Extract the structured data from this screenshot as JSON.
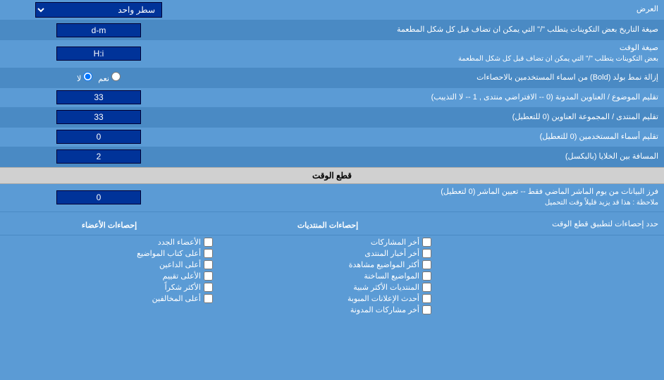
{
  "rows": [
    {
      "id": "row-single-line",
      "label": "",
      "input_type": "select",
      "input_value": "سطر واحد",
      "options": [
        "سطر واحد"
      ],
      "label_right": "العرض"
    },
    {
      "id": "row-date-format",
      "label": "صيغة التاريخ\nبعض التكوينات يتطلب \"/\" التي يمكن ان تضاف قبل كل شكل المطعمة",
      "input_type": "text",
      "input_value": "d-m",
      "label_right": ""
    },
    {
      "id": "row-time-format",
      "label": "صيغة الوقت\nبعض التكوينات يتطلب \"/\" التي يمكن ان تضاف قبل كل شكل المطعمة",
      "input_type": "text",
      "input_value": "H:i",
      "label_right": ""
    },
    {
      "id": "row-bold",
      "label": "إزالة نمط بولد (Bold) من اسماء المستخدمين بالاحصاءات",
      "input_type": "radio",
      "radio_options": [
        "نعم",
        "لا"
      ],
      "radio_selected": "لا",
      "label_right": ""
    },
    {
      "id": "row-sort-topics",
      "label": "تقليم الموضوع / العناوين المدونة (0 -- الافتراضي منتدى , 1 -- لا التذييب)",
      "input_type": "text",
      "input_value": "33",
      "label_right": ""
    },
    {
      "id": "row-sort-forum",
      "label": "تقليم المنتدى / المجموعة العناوين (0 للتعطيل)",
      "input_type": "text",
      "input_value": "33",
      "label_right": ""
    },
    {
      "id": "row-sort-usernames",
      "label": "تقليم أسماء المستخدمين (0 للتعطيل)",
      "input_type": "text",
      "input_value": "0",
      "label_right": ""
    },
    {
      "id": "row-space",
      "label": "المسافة بين الخلايا (بالبكسل)",
      "input_type": "text",
      "input_value": "2",
      "label_right": ""
    }
  ],
  "section_cutoff": {
    "title": "قطع الوقت",
    "row": {
      "label": "فرز البيانات من يوم الماشر الماضي فقط -- تعيين الماشر (0 لتعطيل)\nملاحظة : هذا قد يزيد قليلاً وقت التحميل",
      "input_value": "0"
    }
  },
  "checkboxes_section": {
    "header_label": "حدد إحصاءات لتطبيق قطع الوقت",
    "col1_header": "إحصاءات المنتديات",
    "col1_items": [
      "أخر المشاركات",
      "أخر أخبار المنتدى",
      "أكثر المواضيع مشاهدة",
      "المواضيع الساخنة",
      "المنتديات الأكثر شبية",
      "أحدث الإعلانات المبوبة",
      "أخر مشاركات المدونة"
    ],
    "col2_header": "إحصاءات الأعضاء",
    "col2_items": [
      "الأعضاء الجدد",
      "أعلى كتاب المواضيع",
      "أعلى الداعين",
      "الأعلى تقييم",
      "الأكثر شكراً",
      "أعلى المخالفين"
    ]
  }
}
